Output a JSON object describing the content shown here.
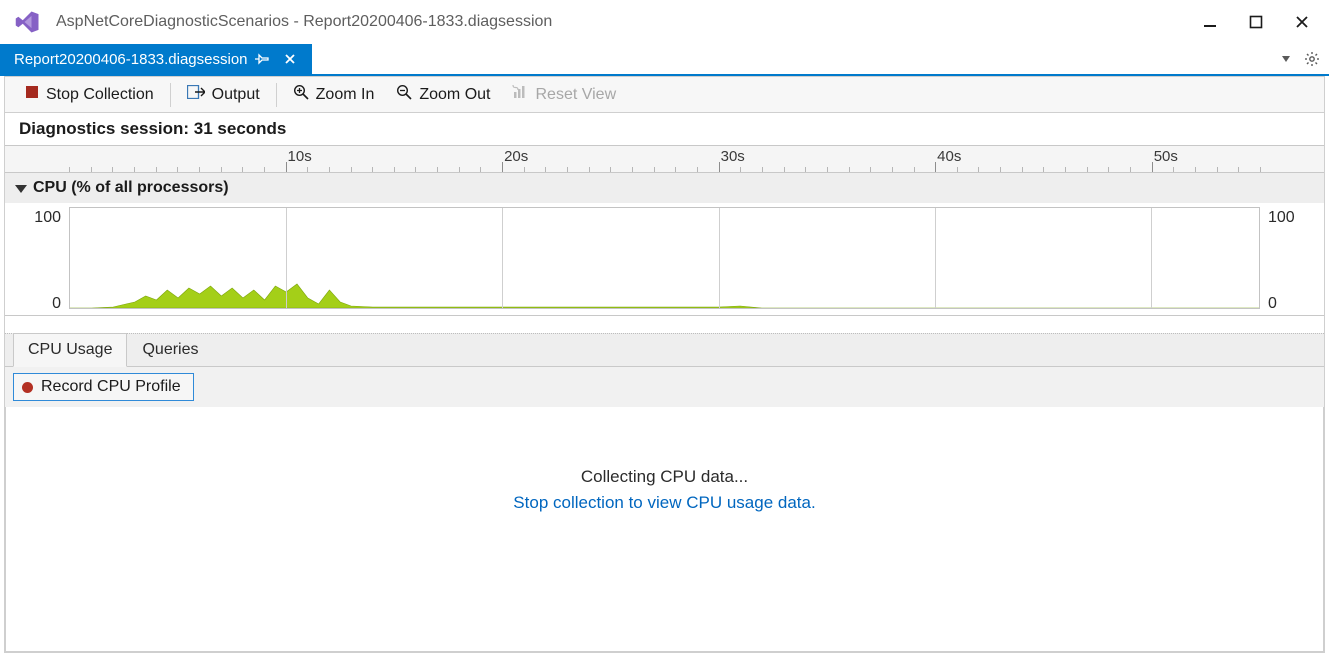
{
  "window": {
    "title": "AspNetCoreDiagnosticScenarios - Report20200406-1833.diagsession"
  },
  "tab": {
    "title": "Report20200406-1833.diagsession"
  },
  "toolbar": {
    "stop": "Stop Collection",
    "output": "Output",
    "zoom_in": "Zoom In",
    "zoom_out": "Zoom Out",
    "reset_view": "Reset View"
  },
  "session_label": "Diagnostics session: 31 seconds",
  "ruler": {
    "majors": [
      "10s",
      "20s",
      "30s",
      "40s",
      "50s"
    ]
  },
  "chart": {
    "title": "CPU (% of all processors)",
    "ymin": "0",
    "ymax": "100"
  },
  "sub_tabs": {
    "cpu": "CPU Usage",
    "queries": "Queries"
  },
  "record_btn": "Record CPU Profile",
  "status": {
    "collecting": "Collecting CPU data...",
    "hint": "Stop collection to view CPU usage data."
  },
  "chart_data": {
    "type": "area",
    "title": "CPU (% of all processors)",
    "xlabel": "seconds",
    "ylabel": "CPU %",
    "xlim": [
      0,
      55
    ],
    "ylim": [
      0,
      100
    ],
    "x": [
      0,
      1,
      2,
      3,
      3.5,
      4,
      4.5,
      5,
      5.5,
      6,
      6.5,
      7,
      7.5,
      8,
      8.5,
      9,
      9.5,
      10,
      10.5,
      11,
      11.5,
      12,
      12.5,
      13,
      14,
      16,
      20,
      25,
      30,
      31,
      32,
      55
    ],
    "values": [
      0,
      0,
      1,
      6,
      12,
      8,
      18,
      10,
      20,
      14,
      22,
      12,
      20,
      10,
      18,
      8,
      22,
      16,
      24,
      10,
      4,
      18,
      6,
      2,
      1,
      1,
      1,
      1,
      1,
      2,
      0,
      0
    ]
  }
}
